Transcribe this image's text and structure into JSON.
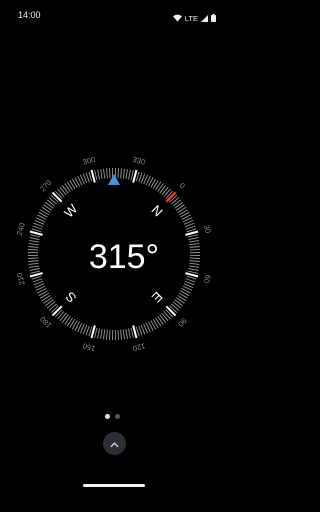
{
  "status_bar": {
    "time": "14:00",
    "network": "LTE",
    "icons": [
      "wifi-icon",
      "signal-icon",
      "battery-icon"
    ]
  },
  "compass": {
    "heading_text": "315°",
    "heading_degrees": 315,
    "degree_labels": [
      "0",
      "30",
      "60",
      "90",
      "120",
      "150",
      "180",
      "210",
      "240",
      "270",
      "300",
      "330"
    ],
    "cardinals": [
      "N",
      "E",
      "S",
      "W"
    ],
    "colors": {
      "north_marker": "#e53935",
      "heading_marker": "#4a90e2",
      "ticks": "#9a9a9a",
      "labels": "#8a8a8a"
    }
  },
  "pager": {
    "page_count": 2,
    "active_page": 1
  },
  "bottom": {
    "expand_icon": "chevron-up-icon"
  }
}
